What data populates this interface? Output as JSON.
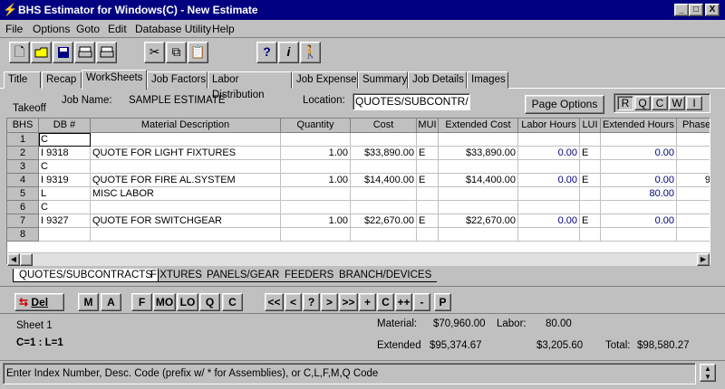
{
  "window": {
    "title": "BHS Estimator for Windows(C) - New Estimate",
    "buttons": [
      "_",
      "□",
      "X"
    ]
  },
  "menu": [
    "File",
    "Options",
    "Goto",
    "Edit",
    "Database Utility",
    "Help"
  ],
  "tabs": [
    "Title",
    "Recap",
    "WorkSheets",
    "Job Factors",
    "Labor Distribution",
    "Job Expense",
    "Summary",
    "Job Details",
    "Images"
  ],
  "active_tab": "WorkSheets",
  "header": {
    "takeoff_label": "Takeoff",
    "job_name_label": "Job Name:",
    "job_name_value": "SAMPLE ESTIMATE",
    "location_label": "Location:",
    "location_value": "QUOTES/SUBCONTR/",
    "page_options_label": "Page Options",
    "mode_buttons": [
      "R",
      "Q",
      "C",
      "W",
      "I"
    ]
  },
  "grid": {
    "columns": [
      "BHS",
      "DB #",
      "Material Description",
      "Quantity",
      "Cost",
      "MUI",
      "Extended Cost",
      "Labor Hours",
      "LUI",
      "Extended Hours",
      "Phase"
    ],
    "rows": [
      {
        "n": "1",
        "db": "C",
        "desc": "",
        "qty": "",
        "cost": "",
        "mui": "",
        "ext_cost": "",
        "labor": "",
        "lui": "",
        "ext_hours": "",
        "phase": ""
      },
      {
        "n": "2",
        "db": "I  9318",
        "desc": "QUOTE FOR LIGHT FIXTURES",
        "qty": "1.00",
        "cost": "$33,890.00",
        "mui": "E",
        "ext_cost": "$33,890.00",
        "labor": "0.00",
        "lui": "E",
        "ext_hours": "0.00",
        "phase": ""
      },
      {
        "n": "3",
        "db": "C",
        "desc": "",
        "qty": "",
        "cost": "",
        "mui": "",
        "ext_cost": "",
        "labor": "",
        "lui": "",
        "ext_hours": "",
        "phase": ""
      },
      {
        "n": "4",
        "db": "I  9319",
        "desc": "QUOTE FOR FIRE AL.SYSTEM",
        "qty": "1.00",
        "cost": "$14,400.00",
        "mui": "E",
        "ext_cost": "$14,400.00",
        "labor": "0.00",
        "lui": "E",
        "ext_hours": "0.00",
        "phase": "9"
      },
      {
        "n": "5",
        "db": "L",
        "desc": "MISC LABOR",
        "qty": "",
        "cost": "",
        "mui": "",
        "ext_cost": "",
        "labor": "",
        "lui": "",
        "ext_hours": "80.00",
        "phase": ""
      },
      {
        "n": "6",
        "db": "C",
        "desc": "",
        "qty": "",
        "cost": "",
        "mui": "",
        "ext_cost": "",
        "labor": "",
        "lui": "",
        "ext_hours": "",
        "phase": ""
      },
      {
        "n": "7",
        "db": "I  9327",
        "desc": "QUOTE FOR SWITCHGEAR",
        "qty": "1.00",
        "cost": "$22,670.00",
        "mui": "E",
        "ext_cost": "$22,670.00",
        "labor": "0.00",
        "lui": "E",
        "ext_hours": "0.00",
        "phase": ""
      },
      {
        "n": "8",
        "db": "",
        "desc": "",
        "qty": "",
        "cost": "",
        "mui": "",
        "ext_cost": "",
        "labor": "",
        "lui": "",
        "ext_hours": "",
        "phase": ""
      }
    ]
  },
  "sheet_tabs": [
    "QUOTES/SUBCONTRACTS",
    "FIXTURES",
    "PANELS/GEAR",
    "FEEDERS",
    "BRANCH/DEVICES"
  ],
  "buttons": {
    "del": "Del",
    "codes": [
      "M",
      "A",
      "F",
      "MO",
      "LO",
      "Q",
      "C"
    ],
    "nav": [
      "<<",
      "<",
      "?",
      ">",
      ">>",
      "+",
      "C",
      "++",
      "-",
      "P"
    ]
  },
  "summary": {
    "sheet": "Sheet 1",
    "counts": "C=1 : L=1",
    "material_label": "Material:",
    "material_value": "$70,960.00",
    "labor_label": "Labor:",
    "labor_value": "80.00",
    "extended_label": "Extended",
    "extended_value": "$95,374.67",
    "extended_labor": "$3,205.60",
    "total_label": "Total:",
    "total_value": "$98,580.27"
  },
  "status": "Enter Index Number, Desc. Code (prefix w/ * for Assemblies), or C,L,F,M,Q Code"
}
